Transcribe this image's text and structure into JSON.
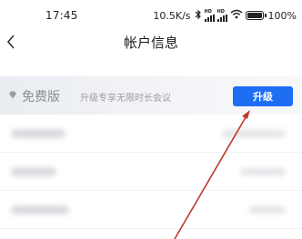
{
  "status_bar": {
    "time": "17:45",
    "network_speed": "10.5K/s",
    "hd_label": "HD",
    "battery": "100%",
    "battery_level": 1.0,
    "icons": [
      "bluetooth-icon",
      "hd-signal-icon",
      "wifi-icon",
      "battery-icon"
    ]
  },
  "nav": {
    "title": "帐户信息",
    "back_icon": "chevron-left-icon"
  },
  "promo": {
    "plan": "免费版",
    "description": "升级专享无限时长会议",
    "upgrade_label": "升级",
    "icon": "diamond-icon",
    "accent": "#1e6ef4"
  },
  "annotation": {
    "color": "#c0392b",
    "icon": "arrow-icon"
  }
}
